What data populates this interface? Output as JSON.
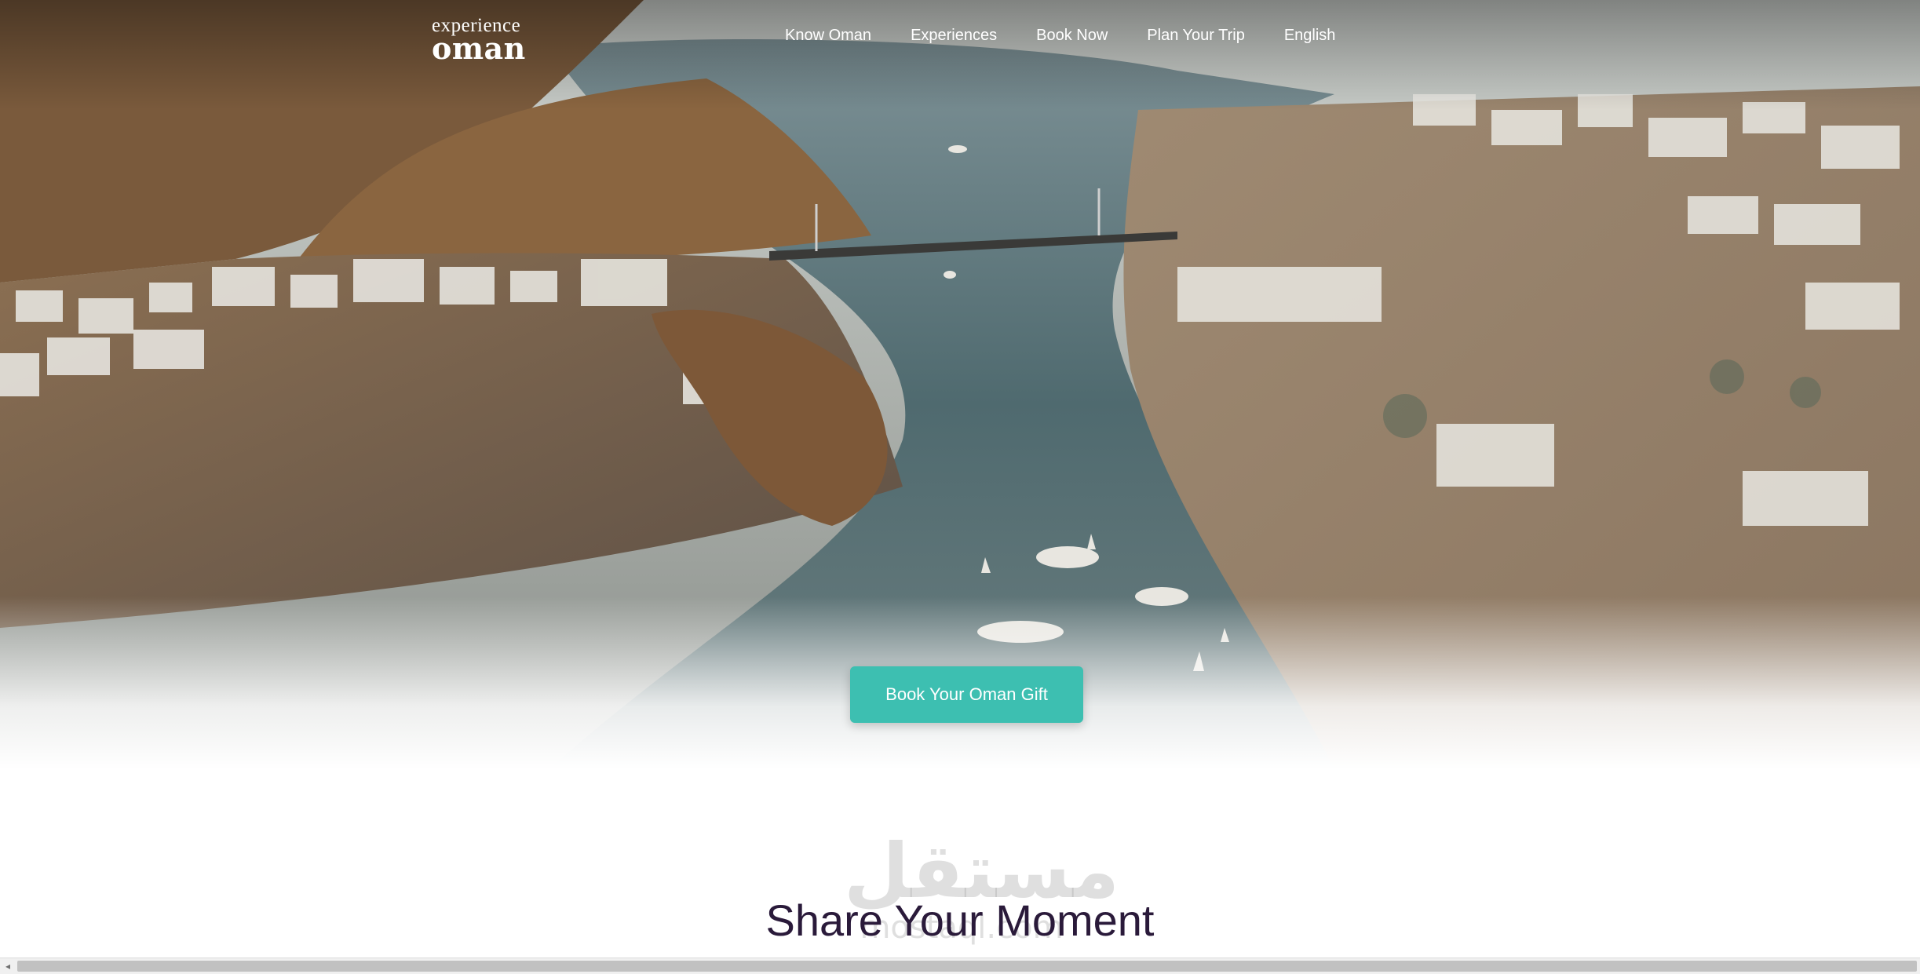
{
  "header": {
    "logo": {
      "line1": "experience",
      "line2": "oman"
    },
    "nav": [
      {
        "label": "Know Oman"
      },
      {
        "label": "Experiences"
      },
      {
        "label": "Book Now"
      },
      {
        "label": "Plan Your Trip"
      },
      {
        "label": "English"
      }
    ]
  },
  "hero": {
    "cta_label": "Book Your Oman Gift",
    "image_description_icon": "aerial-photo"
  },
  "watermark": {
    "line1": "مستقل",
    "line2": "mostaql.com"
  },
  "section": {
    "title": "Share Your Moment"
  },
  "colors": {
    "accent": "#3dbfb1",
    "title": "#2a1a3a",
    "water": "#4f6a6f",
    "sand": "#9a7f62"
  }
}
